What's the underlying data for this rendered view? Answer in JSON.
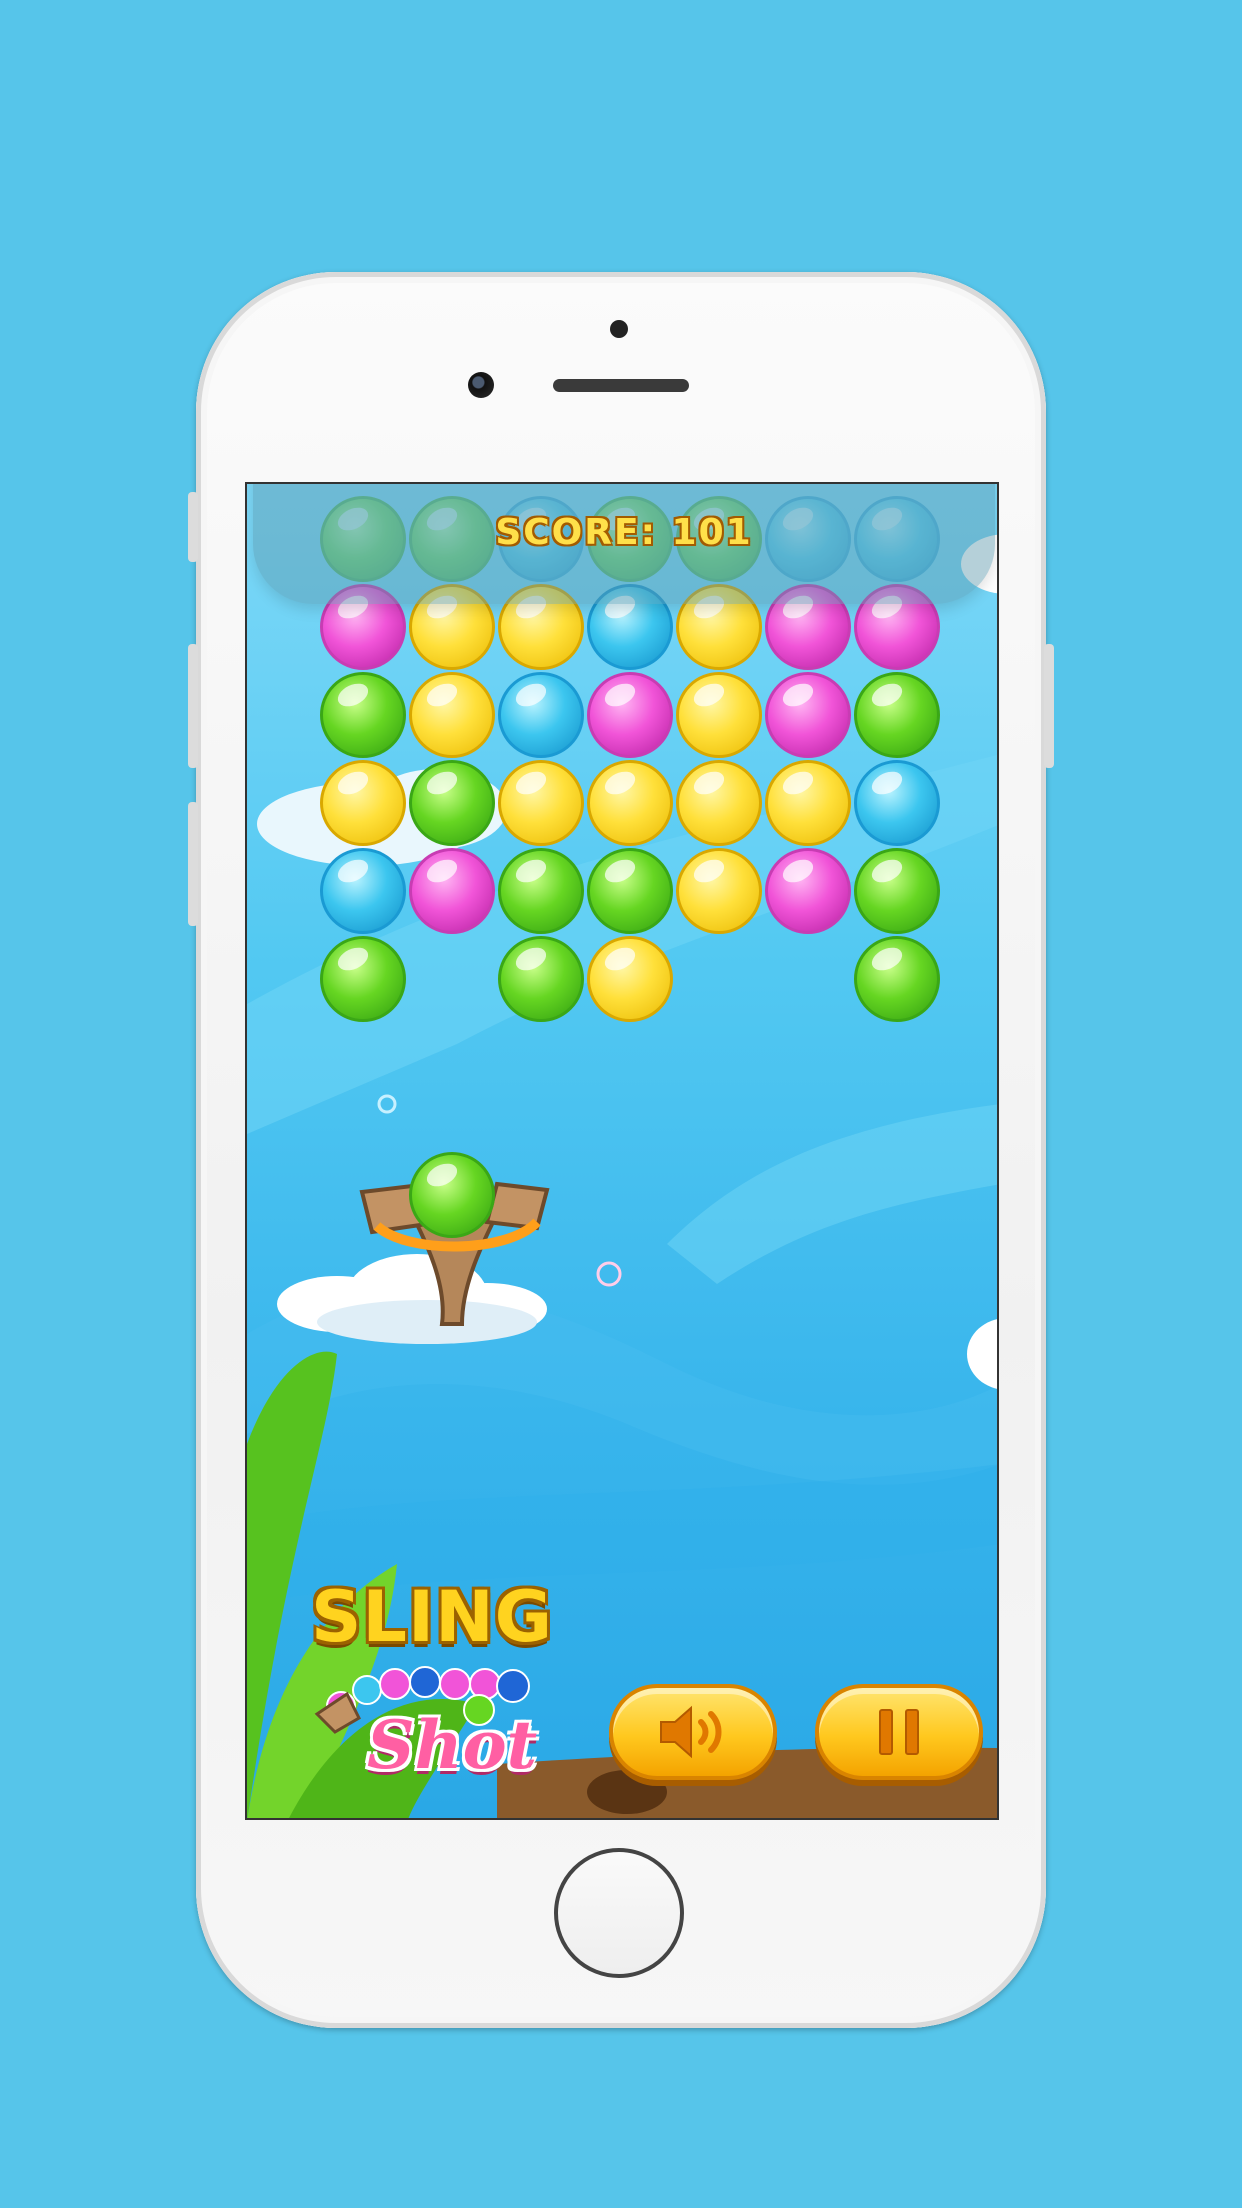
{
  "hud": {
    "score_text": "SCORE: 101"
  },
  "logo": {
    "line1": "SLING",
    "line2": "Shot"
  },
  "controls": {
    "sound_icon": "speaker-icon",
    "pause_icon": "pause-icon"
  },
  "board": {
    "rows": [
      [
        "green",
        "green",
        "blue",
        "green",
        "green",
        "blue",
        "blue"
      ],
      [
        "pink",
        "yellow",
        "yellow",
        "blue",
        "yellow",
        "pink",
        "pink"
      ],
      [
        "green",
        "yellow",
        "blue",
        "pink",
        "yellow",
        "pink",
        "green"
      ],
      [
        "yellow",
        "green",
        "yellow",
        "yellow",
        "yellow",
        "yellow",
        "blue"
      ],
      [
        "blue",
        "pink",
        "green",
        "green",
        "yellow",
        "pink",
        "green"
      ],
      [
        "green",
        "",
        "green",
        "yellow",
        "",
        "",
        "green"
      ]
    ],
    "loaded_bubble": "green"
  },
  "colors": {
    "background": "#56c5ea",
    "pink": "#f154d8",
    "yellow": "#ffe03a",
    "blue": "#3cc6ef",
    "green": "#66d622",
    "button": "#ffc81e"
  }
}
